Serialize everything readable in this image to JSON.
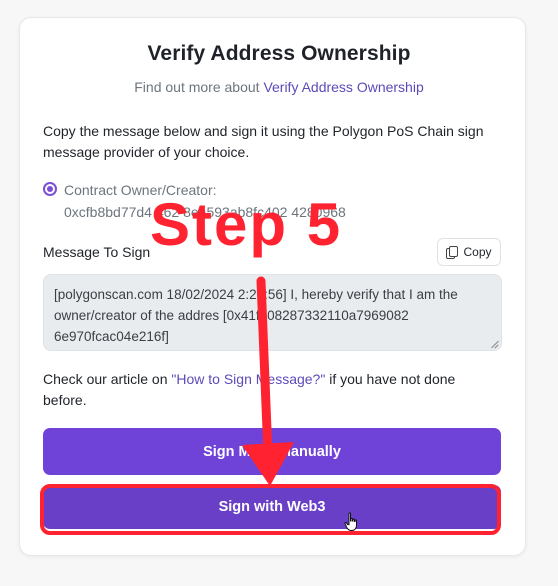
{
  "header": {
    "title": "Verify Address Ownership",
    "subtitle_prefix": "Find out more about ",
    "subtitle_link": "Verify Address Ownership"
  },
  "intro": "Copy the message below and sign it using the Polygon PoS Chain sign message provider of your choice.",
  "owner": {
    "label": "Contract Owner/Creator:",
    "address": "0xcfb8bd77d4  462 8ea593ab8fc402   4280968"
  },
  "message": {
    "label": "Message To Sign",
    "copy_label": "Copy",
    "text": "[polygonscan.com 18/02/2024  2:29:56] I, hereby verify that I am the owner/creator of the addres  [0x41fb08287332110a7969082  6e970fcac04e216f]"
  },
  "check": {
    "prefix": "Check our article on ",
    "link": "\"How to Sign Message?\"",
    "suffix": " if you have not done before."
  },
  "buttons": {
    "manual": "Sign Me     Manually",
    "web3": "Sign with Web3"
  },
  "annotation": {
    "step": "Step 5",
    "color": "#ff2331"
  },
  "colors": {
    "accent": "#6f42d8",
    "link": "#5b4bb8"
  }
}
